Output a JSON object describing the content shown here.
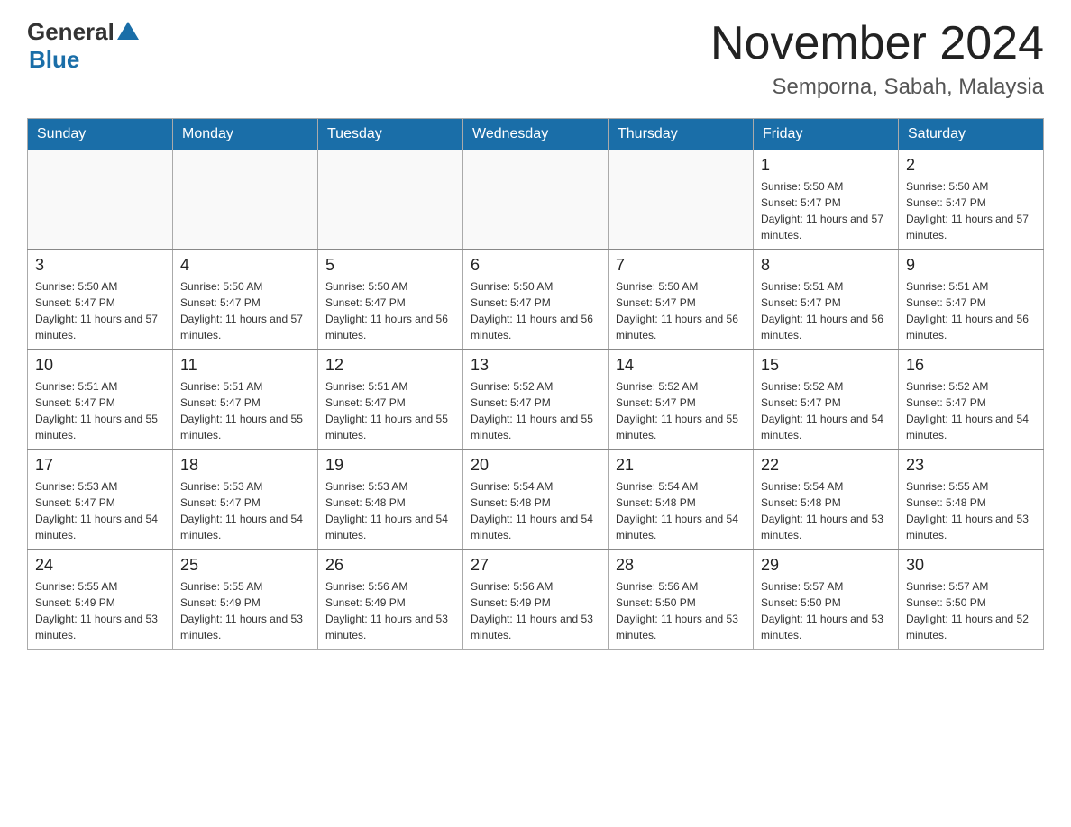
{
  "header": {
    "logo_general": "General",
    "logo_blue": "Blue",
    "month_title": "November 2024",
    "location": "Semporna, Sabah, Malaysia"
  },
  "weekdays": [
    "Sunday",
    "Monday",
    "Tuesday",
    "Wednesday",
    "Thursday",
    "Friday",
    "Saturday"
  ],
  "weeks": [
    [
      {
        "day": "",
        "sunrise": "",
        "sunset": "",
        "daylight": ""
      },
      {
        "day": "",
        "sunrise": "",
        "sunset": "",
        "daylight": ""
      },
      {
        "day": "",
        "sunrise": "",
        "sunset": "",
        "daylight": ""
      },
      {
        "day": "",
        "sunrise": "",
        "sunset": "",
        "daylight": ""
      },
      {
        "day": "",
        "sunrise": "",
        "sunset": "",
        "daylight": ""
      },
      {
        "day": "1",
        "sunrise": "Sunrise: 5:50 AM",
        "sunset": "Sunset: 5:47 PM",
        "daylight": "Daylight: 11 hours and 57 minutes."
      },
      {
        "day": "2",
        "sunrise": "Sunrise: 5:50 AM",
        "sunset": "Sunset: 5:47 PM",
        "daylight": "Daylight: 11 hours and 57 minutes."
      }
    ],
    [
      {
        "day": "3",
        "sunrise": "Sunrise: 5:50 AM",
        "sunset": "Sunset: 5:47 PM",
        "daylight": "Daylight: 11 hours and 57 minutes."
      },
      {
        "day": "4",
        "sunrise": "Sunrise: 5:50 AM",
        "sunset": "Sunset: 5:47 PM",
        "daylight": "Daylight: 11 hours and 57 minutes."
      },
      {
        "day": "5",
        "sunrise": "Sunrise: 5:50 AM",
        "sunset": "Sunset: 5:47 PM",
        "daylight": "Daylight: 11 hours and 56 minutes."
      },
      {
        "day": "6",
        "sunrise": "Sunrise: 5:50 AM",
        "sunset": "Sunset: 5:47 PM",
        "daylight": "Daylight: 11 hours and 56 minutes."
      },
      {
        "day": "7",
        "sunrise": "Sunrise: 5:50 AM",
        "sunset": "Sunset: 5:47 PM",
        "daylight": "Daylight: 11 hours and 56 minutes."
      },
      {
        "day": "8",
        "sunrise": "Sunrise: 5:51 AM",
        "sunset": "Sunset: 5:47 PM",
        "daylight": "Daylight: 11 hours and 56 minutes."
      },
      {
        "day": "9",
        "sunrise": "Sunrise: 5:51 AM",
        "sunset": "Sunset: 5:47 PM",
        "daylight": "Daylight: 11 hours and 56 minutes."
      }
    ],
    [
      {
        "day": "10",
        "sunrise": "Sunrise: 5:51 AM",
        "sunset": "Sunset: 5:47 PM",
        "daylight": "Daylight: 11 hours and 55 minutes."
      },
      {
        "day": "11",
        "sunrise": "Sunrise: 5:51 AM",
        "sunset": "Sunset: 5:47 PM",
        "daylight": "Daylight: 11 hours and 55 minutes."
      },
      {
        "day": "12",
        "sunrise": "Sunrise: 5:51 AM",
        "sunset": "Sunset: 5:47 PM",
        "daylight": "Daylight: 11 hours and 55 minutes."
      },
      {
        "day": "13",
        "sunrise": "Sunrise: 5:52 AM",
        "sunset": "Sunset: 5:47 PM",
        "daylight": "Daylight: 11 hours and 55 minutes."
      },
      {
        "day": "14",
        "sunrise": "Sunrise: 5:52 AM",
        "sunset": "Sunset: 5:47 PM",
        "daylight": "Daylight: 11 hours and 55 minutes."
      },
      {
        "day": "15",
        "sunrise": "Sunrise: 5:52 AM",
        "sunset": "Sunset: 5:47 PM",
        "daylight": "Daylight: 11 hours and 54 minutes."
      },
      {
        "day": "16",
        "sunrise": "Sunrise: 5:52 AM",
        "sunset": "Sunset: 5:47 PM",
        "daylight": "Daylight: 11 hours and 54 minutes."
      }
    ],
    [
      {
        "day": "17",
        "sunrise": "Sunrise: 5:53 AM",
        "sunset": "Sunset: 5:47 PM",
        "daylight": "Daylight: 11 hours and 54 minutes."
      },
      {
        "day": "18",
        "sunrise": "Sunrise: 5:53 AM",
        "sunset": "Sunset: 5:47 PM",
        "daylight": "Daylight: 11 hours and 54 minutes."
      },
      {
        "day": "19",
        "sunrise": "Sunrise: 5:53 AM",
        "sunset": "Sunset: 5:48 PM",
        "daylight": "Daylight: 11 hours and 54 minutes."
      },
      {
        "day": "20",
        "sunrise": "Sunrise: 5:54 AM",
        "sunset": "Sunset: 5:48 PM",
        "daylight": "Daylight: 11 hours and 54 minutes."
      },
      {
        "day": "21",
        "sunrise": "Sunrise: 5:54 AM",
        "sunset": "Sunset: 5:48 PM",
        "daylight": "Daylight: 11 hours and 54 minutes."
      },
      {
        "day": "22",
        "sunrise": "Sunrise: 5:54 AM",
        "sunset": "Sunset: 5:48 PM",
        "daylight": "Daylight: 11 hours and 53 minutes."
      },
      {
        "day": "23",
        "sunrise": "Sunrise: 5:55 AM",
        "sunset": "Sunset: 5:48 PM",
        "daylight": "Daylight: 11 hours and 53 minutes."
      }
    ],
    [
      {
        "day": "24",
        "sunrise": "Sunrise: 5:55 AM",
        "sunset": "Sunset: 5:49 PM",
        "daylight": "Daylight: 11 hours and 53 minutes."
      },
      {
        "day": "25",
        "sunrise": "Sunrise: 5:55 AM",
        "sunset": "Sunset: 5:49 PM",
        "daylight": "Daylight: 11 hours and 53 minutes."
      },
      {
        "day": "26",
        "sunrise": "Sunrise: 5:56 AM",
        "sunset": "Sunset: 5:49 PM",
        "daylight": "Daylight: 11 hours and 53 minutes."
      },
      {
        "day": "27",
        "sunrise": "Sunrise: 5:56 AM",
        "sunset": "Sunset: 5:49 PM",
        "daylight": "Daylight: 11 hours and 53 minutes."
      },
      {
        "day": "28",
        "sunrise": "Sunrise: 5:56 AM",
        "sunset": "Sunset: 5:50 PM",
        "daylight": "Daylight: 11 hours and 53 minutes."
      },
      {
        "day": "29",
        "sunrise": "Sunrise: 5:57 AM",
        "sunset": "Sunset: 5:50 PM",
        "daylight": "Daylight: 11 hours and 53 minutes."
      },
      {
        "day": "30",
        "sunrise": "Sunrise: 5:57 AM",
        "sunset": "Sunset: 5:50 PM",
        "daylight": "Daylight: 11 hours and 52 minutes."
      }
    ]
  ]
}
